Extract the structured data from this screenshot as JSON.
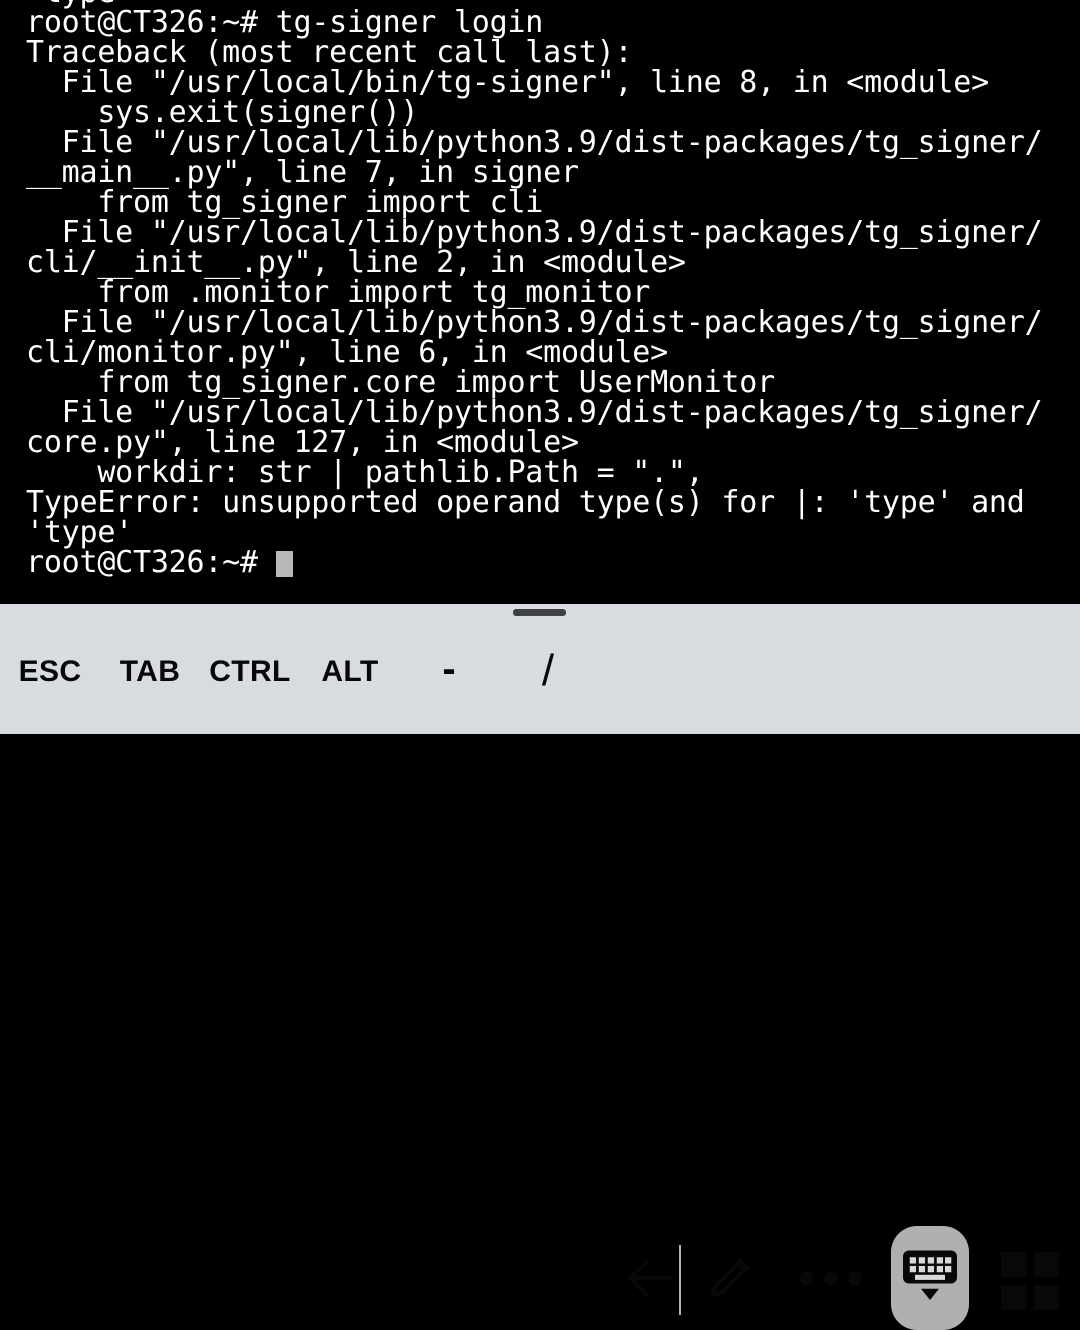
{
  "app": {
    "name": "terminal-emulator",
    "background_color": "#000000",
    "text_color": "#ffffff"
  },
  "terminal": {
    "hostname_prompt": "root@CT326:~#",
    "cursor": "block",
    "cursor_color": "#b8b8b8",
    "lines": [
      " type",
      "root@CT326:~# tg-signer login",
      "Traceback (most recent call last):",
      "  File \"/usr/local/bin/tg-signer\", line 8, in <module>",
      "    sys.exit(signer())",
      "  File \"/usr/local/lib/python3.9/dist-packages/tg_signer/",
      "__main__.py\", line 7, in signer",
      "    from tg_signer import cli",
      "  File \"/usr/local/lib/python3.9/dist-packages/tg_signer/",
      "cli/__init__.py\", line 2, in <module>",
      "    from .monitor import tg_monitor",
      "  File \"/usr/local/lib/python3.9/dist-packages/tg_signer/",
      "cli/monitor.py\", line 6, in <module>",
      "    from tg_signer.core import UserMonitor",
      "  File \"/usr/local/lib/python3.9/dist-packages/tg_signer/",
      "core.py\", line 127, in <module>",
      "    workdir: str | pathlib.Path = \".\",",
      "TypeError: unsupported operand type(s) for |: 'type' and",
      "'type'"
    ],
    "prompt_line_prefix": "root@CT326:~# "
  },
  "toolbar": {
    "background_color": "#d8dce1",
    "foreground_color": "#080808",
    "active_button_color": "#b0b0b0",
    "drag_handle_color": "#3f4144",
    "keys": [
      {
        "id": "esc",
        "label": "ESC"
      },
      {
        "id": "tab",
        "label": "TAB"
      },
      {
        "id": "ctrl",
        "label": "CTRL"
      },
      {
        "id": "alt",
        "label": "ALT"
      },
      {
        "id": "dash",
        "label": "-"
      },
      {
        "id": "slash",
        "label": "/"
      }
    ],
    "icons": [
      {
        "id": "back",
        "name": "back-arrow-icon"
      },
      {
        "id": "pencil",
        "name": "pencil-icon"
      },
      {
        "id": "more",
        "name": "more-dots-icon"
      },
      {
        "id": "keyboard",
        "name": "hide-keyboard-icon",
        "active": true
      },
      {
        "id": "apps",
        "name": "apps-grid-icon"
      }
    ]
  }
}
